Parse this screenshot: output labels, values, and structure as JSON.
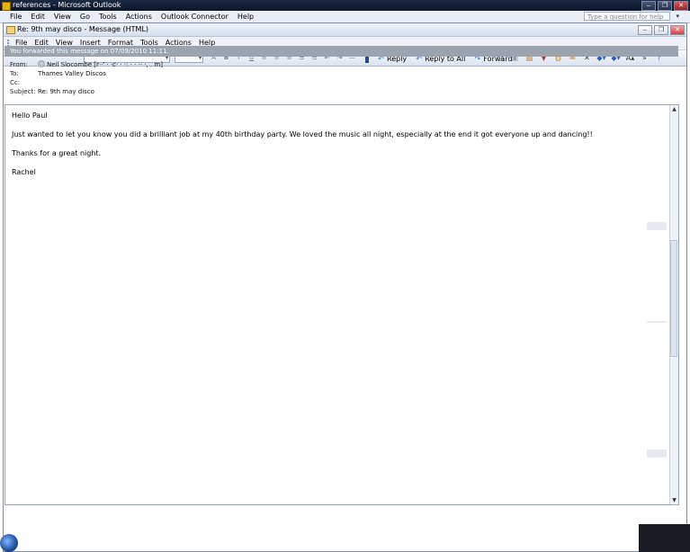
{
  "outer_window": {
    "title": "references - Microsoft Outlook",
    "menu": [
      "File",
      "Edit",
      "View",
      "Go",
      "Tools",
      "Actions",
      "Outlook Connector",
      "Help"
    ],
    "help_placeholder": "Type a question for help",
    "controls": [
      "‒",
      "❐",
      "✕"
    ]
  },
  "message_window": {
    "title": "Re: 9th may disco - Message (HTML)",
    "menu": [
      "File",
      "Edit",
      "View",
      "Insert",
      "Format",
      "Tools",
      "Actions",
      "Help"
    ],
    "controls": [
      "‒",
      "❐",
      "✕"
    ]
  },
  "toolbar": {
    "format_icons": [
      "A",
      "B",
      "I",
      "U"
    ],
    "actions": [
      {
        "label": "Reply",
        "icon": "↶"
      },
      {
        "label": "Reply to All",
        "icon": "↶"
      },
      {
        "label": "Forward",
        "icon": "↷"
      }
    ]
  },
  "info_bar": "You forwarded this message on 07/09/2010 11:11.",
  "header": {
    "from_label": "From:",
    "from_value": "Neil Slocombe [r··' · ·c· · ·: · · ·· ·, . m]",
    "to_label": "To:",
    "to_value": "Thames Valley Discos",
    "cc_label": "Cc:",
    "cc_value": "",
    "subject_label": "Subject:",
    "subject_value": "Re: 9th may disco"
  },
  "body": {
    "greeting": "Hello Paul",
    "paragraph": "Just wanted to let you know you did a brilliant job at my 40th birthday party.  We loved the music all night, especially at the end it got everyone up and dancing!!",
    "thanks": "Thanks for a great night.",
    "signature": "Rachel"
  }
}
